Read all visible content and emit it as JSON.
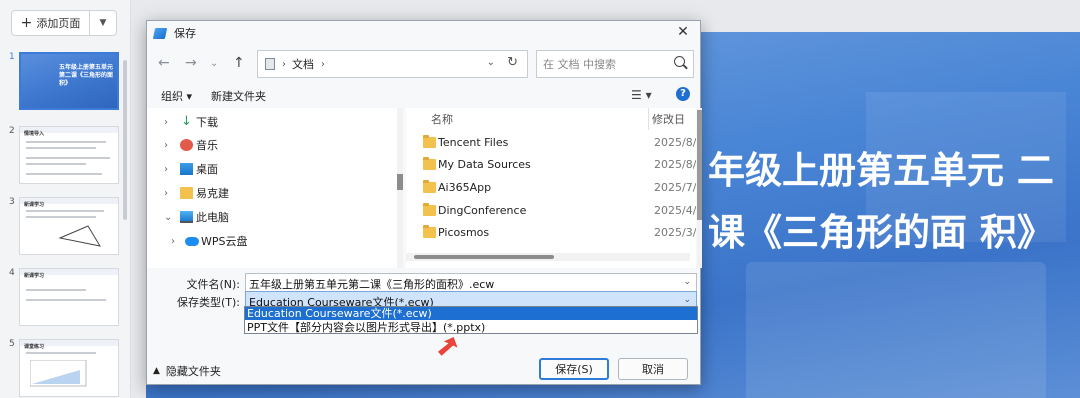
{
  "left_panel": {
    "add_page_label": "添加页面",
    "thumbnails": [
      {
        "num": "1",
        "title": "五年级上册第五单元第二课《三角形的面积》"
      },
      {
        "num": "2",
        "title": "情境导入"
      },
      {
        "num": "3",
        "title": "新课学习"
      },
      {
        "num": "4",
        "title": "新课学习"
      },
      {
        "num": "5",
        "title": "课堂练习"
      }
    ]
  },
  "slide": {
    "title": "年级上册第五单元 二课《三角形的面 积》"
  },
  "dialog": {
    "title": "保存",
    "close_glyph": "✕",
    "address": {
      "location": "文档",
      "arrow": "›"
    },
    "search_placeholder": "在 文档 中搜索",
    "toolbar": {
      "organize": "组织 ▾",
      "new_folder": "新建文件夹",
      "view": "☰ ▾",
      "help": "?"
    },
    "nav_items": [
      {
        "label": "下载",
        "icon": "download-icon"
      },
      {
        "label": "音乐",
        "icon": "music-icon"
      },
      {
        "label": "桌面",
        "icon": "desktop-icon"
      },
      {
        "label": "易克建",
        "icon": "folder-icon"
      },
      {
        "label": "此电脑",
        "icon": "pc-icon"
      },
      {
        "label": "WPS云盘",
        "icon": "cloud-icon"
      }
    ],
    "columns": {
      "name": "名称",
      "modified": "修改日"
    },
    "files": [
      {
        "name": "Tencent Files",
        "date": "2025/8/"
      },
      {
        "name": "My Data Sources",
        "date": "2025/8/"
      },
      {
        "name": "Ai365App",
        "date": "2025/7/"
      },
      {
        "name": "DingConference",
        "date": "2025/4/"
      },
      {
        "name": "Picosmos",
        "date": "2025/3/"
      }
    ],
    "filename_label": "文件名(N):",
    "filename_value": "五年级上册第五单元第二课《三角形的面积》.ecw",
    "filetype_label": "保存类型(T):",
    "filetype_value": "Education Courseware文件(*.ecw)",
    "filetype_options": [
      "Education Courseware文件(*.ecw)",
      "PPT文件【部分内容会以图片形式导出】(*.pptx)"
    ],
    "hide_folders": "隐藏文件夹",
    "save_button": "保存(S)",
    "cancel_button": "取消"
  }
}
